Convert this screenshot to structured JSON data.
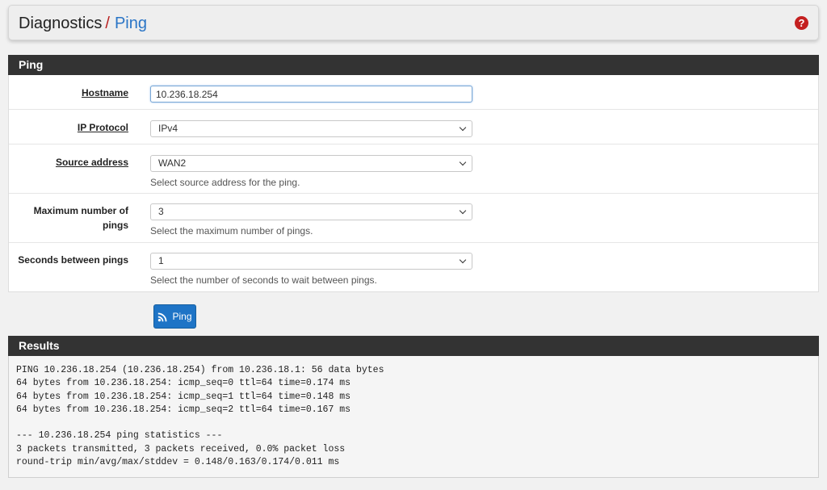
{
  "breadcrumb": {
    "first": "Diagnostics",
    "separator": "/",
    "current": "Ping"
  },
  "help_icon": "question-circle-icon",
  "ping_panel": {
    "title": "Ping",
    "fields": {
      "hostname": {
        "label": "Hostname",
        "value": "10.236.18.254"
      },
      "ip_protocol": {
        "label": "IP Protocol",
        "value": "IPv4"
      },
      "source_address": {
        "label": "Source address",
        "value": "WAN2",
        "help": "Select source address for the ping."
      },
      "max_pings": {
        "label": "Maximum number of pings",
        "value": "3",
        "help": "Select the maximum number of pings."
      },
      "seconds_between": {
        "label": "Seconds between pings",
        "value": "1",
        "help": "Select the number of seconds to wait between pings."
      }
    }
  },
  "ping_button": {
    "label": "Ping",
    "icon": "rss-icon"
  },
  "results_panel": {
    "title": "Results",
    "output": "PING 10.236.18.254 (10.236.18.254) from 10.236.18.1: 56 data bytes\n64 bytes from 10.236.18.254: icmp_seq=0 ttl=64 time=0.174 ms\n64 bytes from 10.236.18.254: icmp_seq=1 ttl=64 time=0.148 ms\n64 bytes from 10.236.18.254: icmp_seq=2 ttl=64 time=0.167 ms\n\n--- 10.236.18.254 ping statistics ---\n3 packets transmitted, 3 packets received, 0.0% packet loss\nround-trip min/avg/max/stddev = 0.148/0.163/0.174/0.011 ms"
  },
  "colors": {
    "panel_heading": "#333333",
    "breadcrumb_separator": "#b81f1f",
    "breadcrumb_current": "#2a75c6",
    "primary_button": "#1e74c6",
    "help_icon": "#c42020"
  }
}
